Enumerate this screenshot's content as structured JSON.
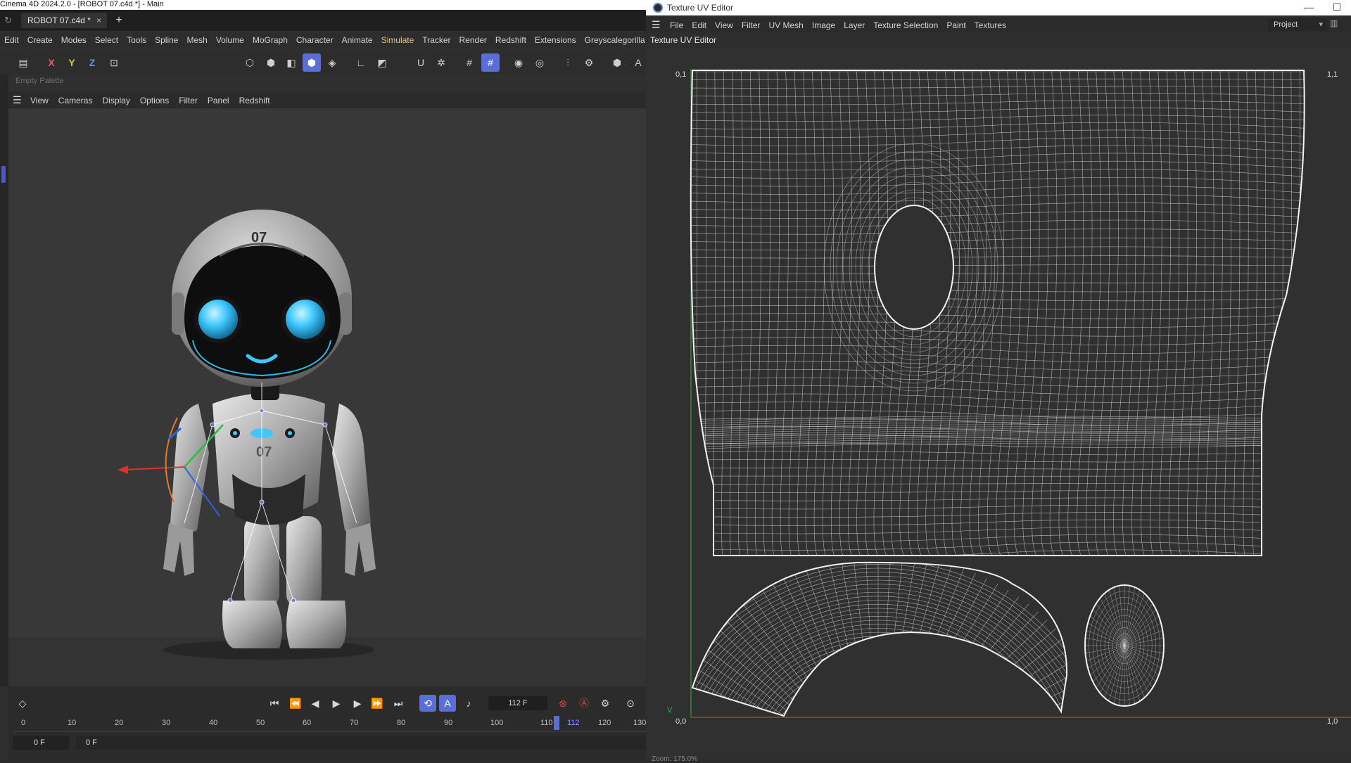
{
  "main_window": {
    "title": "Cinema 4D 2024.2.0 - [ROBOT 07.c4d *] - Main",
    "tab": {
      "label": "ROBOT 07.c4d *",
      "close": "×"
    },
    "new_tab": "+",
    "menus": [
      "Edit",
      "Create",
      "Modes",
      "Select",
      "Tools",
      "Spline",
      "Mesh",
      "Volume",
      "MoGraph",
      "Character",
      "Animate",
      "Simulate",
      "Tracker",
      "Render",
      "Redshift",
      "Extensions",
      "Greyscalegorilla"
    ],
    "active_menu": "Simulate",
    "axis_buttons": {
      "x": "X",
      "y": "Y",
      "z": "Z"
    },
    "palette_label": "Empty Palette",
    "viewport_menus": [
      "View",
      "Cameras",
      "Display",
      "Options",
      "Filter",
      "Panel",
      "Redshift"
    ],
    "robot_label_head": "07",
    "robot_label_chest": "07"
  },
  "timeline": {
    "current_frame": "112 F",
    "ticks": [
      "0",
      "10",
      "20",
      "30",
      "40",
      "50",
      "60",
      "70",
      "80",
      "90",
      "100",
      "110",
      "112",
      "120",
      "130"
    ],
    "start_field": "0 F",
    "end_field": "0 F"
  },
  "uv_editor": {
    "window_title": "Texture UV Editor",
    "menus": [
      "File",
      "Edit",
      "View",
      "Filter",
      "UV Mesh",
      "Image",
      "Layer",
      "Texture Selection",
      "Paint",
      "Textures"
    ],
    "project_dropdown": "Project",
    "panel_label": "Texture UV Editor",
    "corner_labels": {
      "top_left": "0,1",
      "top_right": "1,1",
      "bottom_left": "0,0",
      "bottom_right": "1,0",
      "v_axis": "V"
    },
    "zoom_text": "Zoom: 175.0%"
  },
  "colors": {
    "accent": "#5b6ed6",
    "simulate_menu": "#e5c07b",
    "uv_wire": "#d9d9d9",
    "eye_glow": "#3fc8ff"
  }
}
